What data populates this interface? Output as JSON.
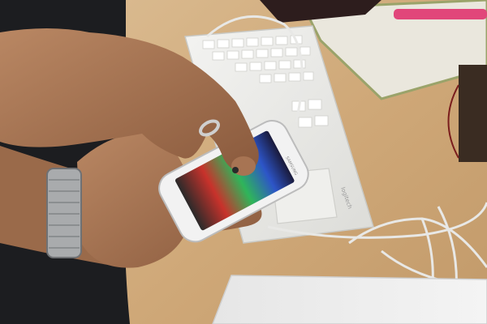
{
  "photo": {
    "keyboard_brand": "logitech",
    "phone_brand": "SAMSUNG"
  }
}
